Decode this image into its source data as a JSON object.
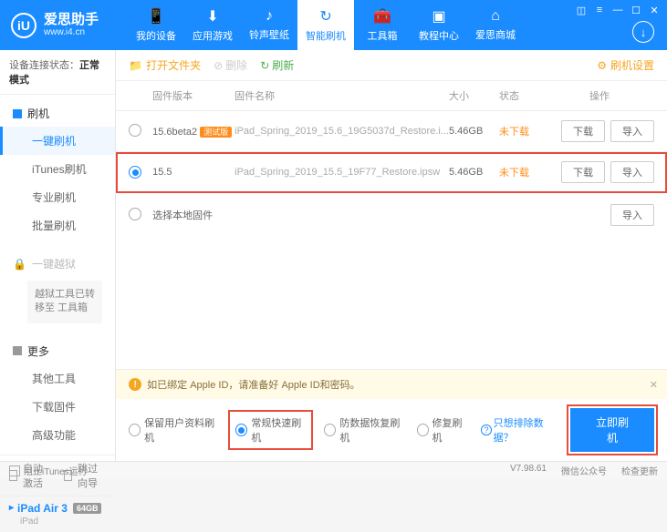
{
  "header": {
    "app_name": "爱思助手",
    "url": "www.i4.cn",
    "logo_char": "iU",
    "nav": [
      {
        "icon": "📱",
        "label": "我的设备"
      },
      {
        "icon": "⬇",
        "label": "应用游戏"
      },
      {
        "icon": "♪",
        "label": "铃声壁纸"
      },
      {
        "icon": "↻",
        "label": "智能刷机"
      },
      {
        "icon": "🧰",
        "label": "工具箱"
      },
      {
        "icon": "▣",
        "label": "教程中心"
      },
      {
        "icon": "⌂",
        "label": "爱思商城"
      }
    ],
    "round_icon": "↓"
  },
  "sidebar": {
    "conn_label": "设备连接状态：",
    "conn_value": "正常模式",
    "flash": {
      "head": "刷机",
      "items": [
        "一键刷机",
        "iTunes刷机",
        "专业刷机",
        "批量刷机"
      ]
    },
    "jailbreak": {
      "head": "一键越狱",
      "moved": "越狱工具已转移至\n工具箱"
    },
    "more": {
      "head": "更多",
      "items": [
        "其他工具",
        "下载固件",
        "高级功能"
      ]
    },
    "auto_activate": "自动激活",
    "skip_guide": "跳过向导",
    "device": {
      "name": "iPad Air 3",
      "capacity": "64GB",
      "sub": "iPad"
    }
  },
  "toolbar": {
    "open_folder": "打开文件夹",
    "delete": "删除",
    "refresh": "刷新",
    "settings": "刷机设置"
  },
  "table": {
    "headers": {
      "version": "固件版本",
      "name": "固件名称",
      "size": "大小",
      "status": "状态",
      "ops": "操作"
    },
    "rows": [
      {
        "selected": false,
        "version": "15.6beta2",
        "badge": "测试版",
        "name": "iPad_Spring_2019_15.6_19G5037d_Restore.i...",
        "size": "5.46GB",
        "status": "未下载"
      },
      {
        "selected": true,
        "version": "15.5",
        "badge": "",
        "name": "iPad_Spring_2019_15.5_19F77_Restore.ipsw",
        "size": "5.46GB",
        "status": "未下载"
      }
    ],
    "local": "选择本地固件",
    "btn_download": "下载",
    "btn_import": "导入"
  },
  "bottom": {
    "warning": "如已绑定 Apple ID，请准备好 Apple ID和密码。",
    "options": [
      {
        "label": "保留用户资料刷机",
        "on": false
      },
      {
        "label": "常规快速刷机",
        "on": true
      },
      {
        "label": "防数据恢复刷机",
        "on": false
      },
      {
        "label": "修复刷机",
        "on": false
      }
    ],
    "exclude_link": "只想排除数据？",
    "flash_btn": "立即刷机"
  },
  "statusbar": {
    "block_itunes": "阻止iTunes运行",
    "version": "V7.98.61",
    "wechat": "微信公众号",
    "update": "检查更新"
  }
}
